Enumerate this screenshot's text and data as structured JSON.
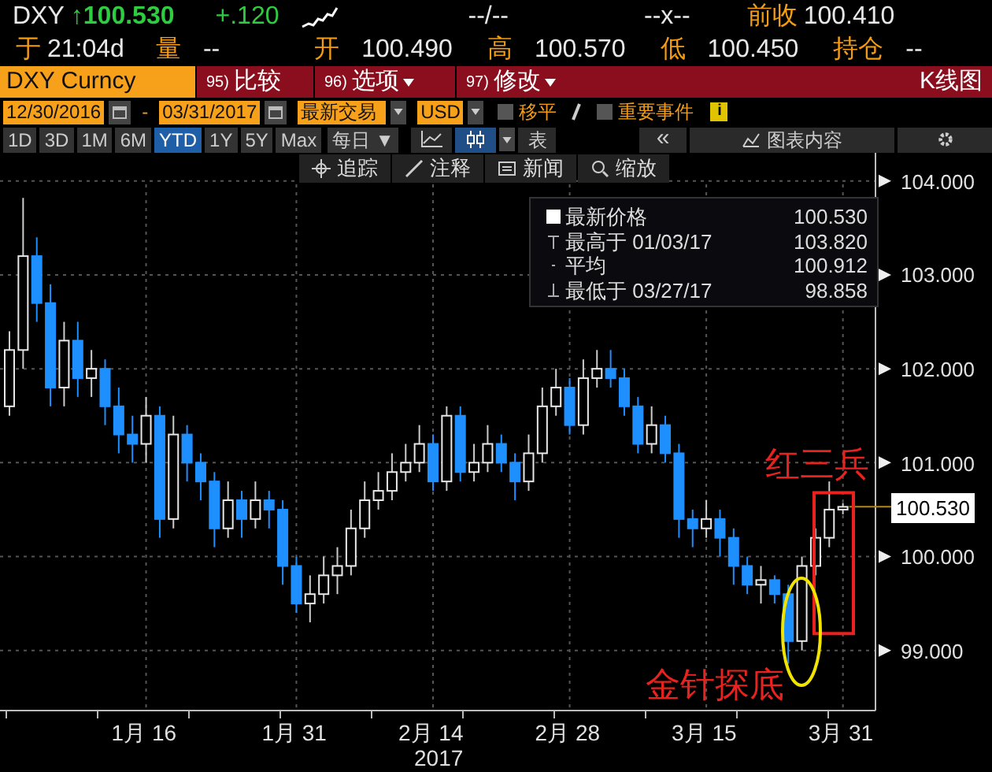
{
  "quote_header": {
    "ticker": "DXY",
    "arrow": "↑",
    "price": "100.530",
    "change": "+.120",
    "bid_ask": "--/--",
    "size": "--x--",
    "prev_close_label": "前收",
    "prev_close": "100.410"
  },
  "stats_row": [
    {
      "label": "于",
      "value": "21:04d"
    },
    {
      "label": "量",
      "value": "--"
    },
    {
      "label": "开",
      "value": "100.490"
    },
    {
      "label": "高",
      "value": "100.570"
    },
    {
      "label": "低",
      "value": "100.450"
    },
    {
      "label": "持仓",
      "value": "--"
    }
  ],
  "command_bar": {
    "security": "DXY Curncy",
    "menus": [
      {
        "number": "95)",
        "label": "比较",
        "dropdown": false
      },
      {
        "number": "96)",
        "label": "选项",
        "dropdown": true
      },
      {
        "number": "97)",
        "label": "修改",
        "dropdown": true
      }
    ],
    "title": "K线图"
  },
  "range_bar": {
    "start_date": "12/30/2016",
    "separator": "-",
    "end_date": "03/31/2017",
    "price_type": "最新交易",
    "currency": "USD",
    "options": [
      {
        "label": "移平",
        "checked": false
      },
      {
        "label": "重要事件",
        "checked": false
      }
    ],
    "info": "i"
  },
  "periods": [
    {
      "label": "1D",
      "selected": false
    },
    {
      "label": "3D",
      "selected": false
    },
    {
      "label": "1M",
      "selected": false
    },
    {
      "label": "6M",
      "selected": false
    },
    {
      "label": "YTD",
      "selected": true
    },
    {
      "label": "1Y",
      "selected": false
    },
    {
      "label": "5Y",
      "selected": false
    },
    {
      "label": "Max",
      "selected": false
    }
  ],
  "toolbar": {
    "frequency": "每日 ▼",
    "table": "表",
    "collapse": "«",
    "chart_content": "图表内容"
  },
  "chart_tools": [
    "追踪",
    "注释",
    "新闻",
    "缩放"
  ],
  "legend": [
    {
      "kind": "last",
      "label": "最新价格",
      "value": "100.530"
    },
    {
      "kind": "high",
      "label": "最高于 01/03/17",
      "value": "103.820"
    },
    {
      "kind": "avg",
      "label": "平均",
      "value": "100.912"
    },
    {
      "kind": "low",
      "label": "最低于 03/27/17",
      "value": "98.858"
    }
  ],
  "chart_data": {
    "type": "candlestick",
    "categories": [
      null,
      null,
      null,
      null,
      null,
      null,
      null,
      null,
      null,
      null,
      "1月 16",
      null,
      null,
      null,
      null,
      null,
      null,
      null,
      null,
      null,
      null,
      "1月 31",
      null,
      null,
      null,
      null,
      null,
      null,
      null,
      null,
      null,
      "2月 14",
      null,
      null,
      null,
      null,
      null,
      null,
      null,
      null,
      null,
      "2月 28",
      null,
      null,
      null,
      null,
      null,
      null,
      null,
      null,
      null,
      "3月 15",
      null,
      null,
      null,
      null,
      null,
      null,
      null,
      null,
      null,
      "3月 31"
    ],
    "ohlc": [
      [
        101.6,
        102.4,
        101.5,
        102.2
      ],
      [
        102.2,
        103.82,
        102.0,
        103.2
      ],
      [
        103.2,
        103.4,
        102.5,
        102.7
      ],
      [
        102.7,
        102.9,
        101.6,
        101.8
      ],
      [
        101.8,
        102.5,
        101.6,
        102.3
      ],
      [
        102.3,
        102.5,
        101.7,
        101.9
      ],
      [
        101.9,
        102.2,
        101.7,
        102.0
      ],
      [
        102.0,
        102.1,
        101.4,
        101.6
      ],
      [
        101.6,
        101.8,
        101.1,
        101.3
      ],
      [
        101.3,
        101.5,
        101.0,
        101.2
      ],
      [
        101.2,
        101.7,
        101.0,
        101.5
      ],
      [
        101.5,
        101.6,
        100.2,
        100.4
      ],
      [
        100.4,
        101.5,
        100.3,
        101.3
      ],
      [
        101.3,
        101.4,
        100.8,
        101.0
      ],
      [
        101.0,
        101.1,
        100.6,
        100.8
      ],
      [
        100.8,
        100.9,
        100.1,
        100.3
      ],
      [
        100.3,
        100.8,
        100.2,
        100.6
      ],
      [
        100.6,
        100.7,
        100.2,
        100.4
      ],
      [
        100.4,
        100.8,
        100.3,
        100.6
      ],
      [
        100.6,
        100.7,
        100.3,
        100.5
      ],
      [
        100.5,
        100.6,
        99.7,
        99.9
      ],
      [
        99.9,
        100.0,
        99.4,
        99.5
      ],
      [
        99.5,
        99.8,
        99.3,
        99.6
      ],
      [
        99.6,
        100.0,
        99.5,
        99.8
      ],
      [
        99.8,
        100.1,
        99.6,
        99.9
      ],
      [
        99.9,
        100.5,
        99.8,
        100.3
      ],
      [
        100.3,
        100.8,
        100.2,
        100.6
      ],
      [
        100.6,
        100.9,
        100.5,
        100.7
      ],
      [
        100.7,
        101.1,
        100.6,
        100.9
      ],
      [
        100.9,
        101.2,
        100.8,
        101.0
      ],
      [
        101.0,
        101.4,
        100.9,
        101.2
      ],
      [
        101.2,
        101.3,
        100.7,
        100.8
      ],
      [
        100.8,
        101.6,
        100.7,
        101.5
      ],
      [
        101.5,
        101.6,
        100.8,
        100.9
      ],
      [
        100.9,
        101.2,
        100.8,
        101.0
      ],
      [
        101.0,
        101.4,
        100.9,
        101.2
      ],
      [
        101.2,
        101.3,
        100.9,
        101.0
      ],
      [
        101.0,
        101.1,
        100.6,
        100.8
      ],
      [
        100.8,
        101.3,
        100.7,
        101.1
      ],
      [
        101.1,
        101.8,
        101.0,
        101.6
      ],
      [
        101.6,
        102.0,
        101.5,
        101.8
      ],
      [
        101.8,
        101.9,
        101.3,
        101.4
      ],
      [
        101.4,
        102.1,
        101.3,
        101.9
      ],
      [
        101.9,
        102.2,
        101.8,
        102.0
      ],
      [
        102.0,
        102.2,
        101.8,
        101.9
      ],
      [
        101.9,
        102.0,
        101.5,
        101.6
      ],
      [
        101.6,
        101.7,
        101.1,
        101.2
      ],
      [
        101.2,
        101.6,
        101.1,
        101.4
      ],
      [
        101.4,
        101.5,
        101.0,
        101.1
      ],
      [
        101.1,
        101.2,
        100.2,
        100.4
      ],
      [
        100.4,
        100.5,
        100.1,
        100.3
      ],
      [
        100.3,
        100.6,
        100.2,
        100.4
      ],
      [
        100.4,
        100.5,
        100.0,
        100.2
      ],
      [
        100.2,
        100.3,
        99.7,
        99.9
      ],
      [
        99.9,
        100.0,
        99.6,
        99.7
      ],
      [
        99.7,
        99.9,
        99.5,
        99.75
      ],
      [
        99.75,
        99.8,
        99.5,
        99.6
      ],
      [
        99.6,
        99.7,
        98.858,
        99.1
      ],
      [
        99.1,
        100.0,
        99.0,
        99.9
      ],
      [
        99.9,
        100.3,
        99.8,
        100.2
      ],
      [
        100.2,
        100.8,
        100.1,
        100.5
      ],
      [
        100.5,
        100.57,
        100.45,
        100.53
      ]
    ],
    "ylim": [
      98.36,
      104.3
    ],
    "yticks": [
      {
        "value": 104,
        "label": "104.000"
      },
      {
        "value": 103,
        "label": "103.000"
      },
      {
        "value": 102,
        "label": "102.000"
      },
      {
        "value": 101,
        "label": "101.000"
      },
      {
        "value": 100,
        "label": "100.000"
      },
      {
        "value": 99,
        "label": "99.000"
      }
    ],
    "xlabel": "2017",
    "grid": true
  },
  "current_price": "100.530",
  "annotations": [
    {
      "kind": "box",
      "text": "红三兵"
    },
    {
      "kind": "ellipse",
      "text": "金针探底"
    }
  ]
}
